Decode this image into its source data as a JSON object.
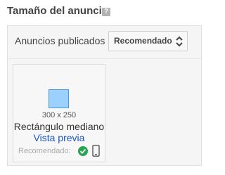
{
  "header": {
    "title": "Tamaño del anuncio",
    "help_icon": "help-icon",
    "help_glyph": "?"
  },
  "panel": {
    "row_label": "Anuncios publicados",
    "select": {
      "value": "Recomendado",
      "icon": "chevron-up-down-icon"
    }
  },
  "card": {
    "dimensions": "300 x 250",
    "name": "Rectángulo mediano",
    "preview_link": "Vista previa",
    "recommended_label": "Recomendado:",
    "status_icon": "check-circle-icon",
    "device_icon": "mobile-phone-icon"
  },
  "colors": {
    "link": "#1a56c5",
    "check": "#27a552",
    "preview_fill": "#9bd0ff"
  }
}
